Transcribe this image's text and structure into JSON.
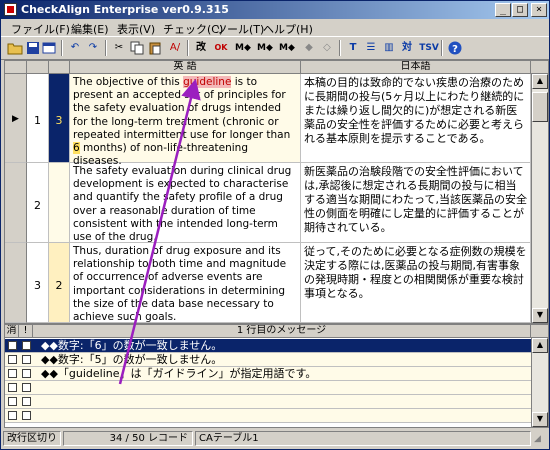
{
  "window": {
    "title": "CheckAlign Enterprise ver0.9.315",
    "controls": [
      "_",
      "□",
      "×"
    ]
  },
  "menu": [
    "ファイル(F)",
    "編集(E)",
    "表示(V)",
    "チェック(C)",
    "ツール(T)",
    "ヘルプ(H)"
  ],
  "toolbar": {
    "labels": [
      "改",
      "OK",
      "M◆",
      "M◆",
      "M◆",
      "対",
      "TSV"
    ]
  },
  "grid": {
    "headers": {
      "english": "英 語",
      "japanese": "日本語"
    },
    "rows": [
      {
        "num": "1",
        "count": "3",
        "en_parts": [
          "The objective of this ",
          "guideline",
          " is to present an accepted set of principles for the safety evaluation of drugs intended for the long-term treatment (chronic or repeated intermittent use for longer than ",
          "6",
          " months) of non-life-threatening diseases."
        ],
        "ja": "本稿の目的は致命的でない疾患の治療のために長期間の投与(5ヶ月以上にわたり継続的にまたは繰り返し間欠的に)が想定される新医薬品の安全性を評価するために必要と考えられる基本原則を提示することである。"
      },
      {
        "num": "2",
        "count": "",
        "en": "The safety evaluation during clinical drug development is expected to characterise and quantify the safety profile of a drug over a reasonable duration of time consistent with the intended long-term use of the drug.",
        "ja": "新医薬品の治験段階での安全性評価においては,承認後に想定される長期間の投与に相当する適当な期間にわたって,当該医薬品の安全性の側面を明確にし定量的に評価することが期待されている。"
      },
      {
        "num": "3",
        "count": "2",
        "en": "Thus, duration of drug exposure and its relationship to both time and magnitude of occurrence of adverse events are important considerations in determining the size of the data base necessary to achieve such goals.",
        "ja": "従って,そのために必要となる症例数の規模を決定する際には,医薬品の投与期間,有害事象の発現時期・程度との相関関係が重要な検討事項となる。"
      }
    ]
  },
  "messages": {
    "col_del": "消",
    "col_excl": "!",
    "header": "1 行目のメッセージ",
    "items": [
      "◆◆数字:「6」の数が一致しません。",
      "◆◆数字:「5」の数が一致しません。",
      "◆◆「guideline」は「ガイドライン」が指定用語です。"
    ]
  },
  "status": {
    "mode": "改行区切り",
    "records": "34 / 50 レコード",
    "table": "CAテーブル1"
  },
  "colors": {
    "title_start": "#0a246a",
    "selected_row": "#0a246a",
    "highlight_red": "#f4b8b8",
    "highlight_yellow": "#ffe060",
    "annotation_arrow": "#9b1fbf"
  }
}
